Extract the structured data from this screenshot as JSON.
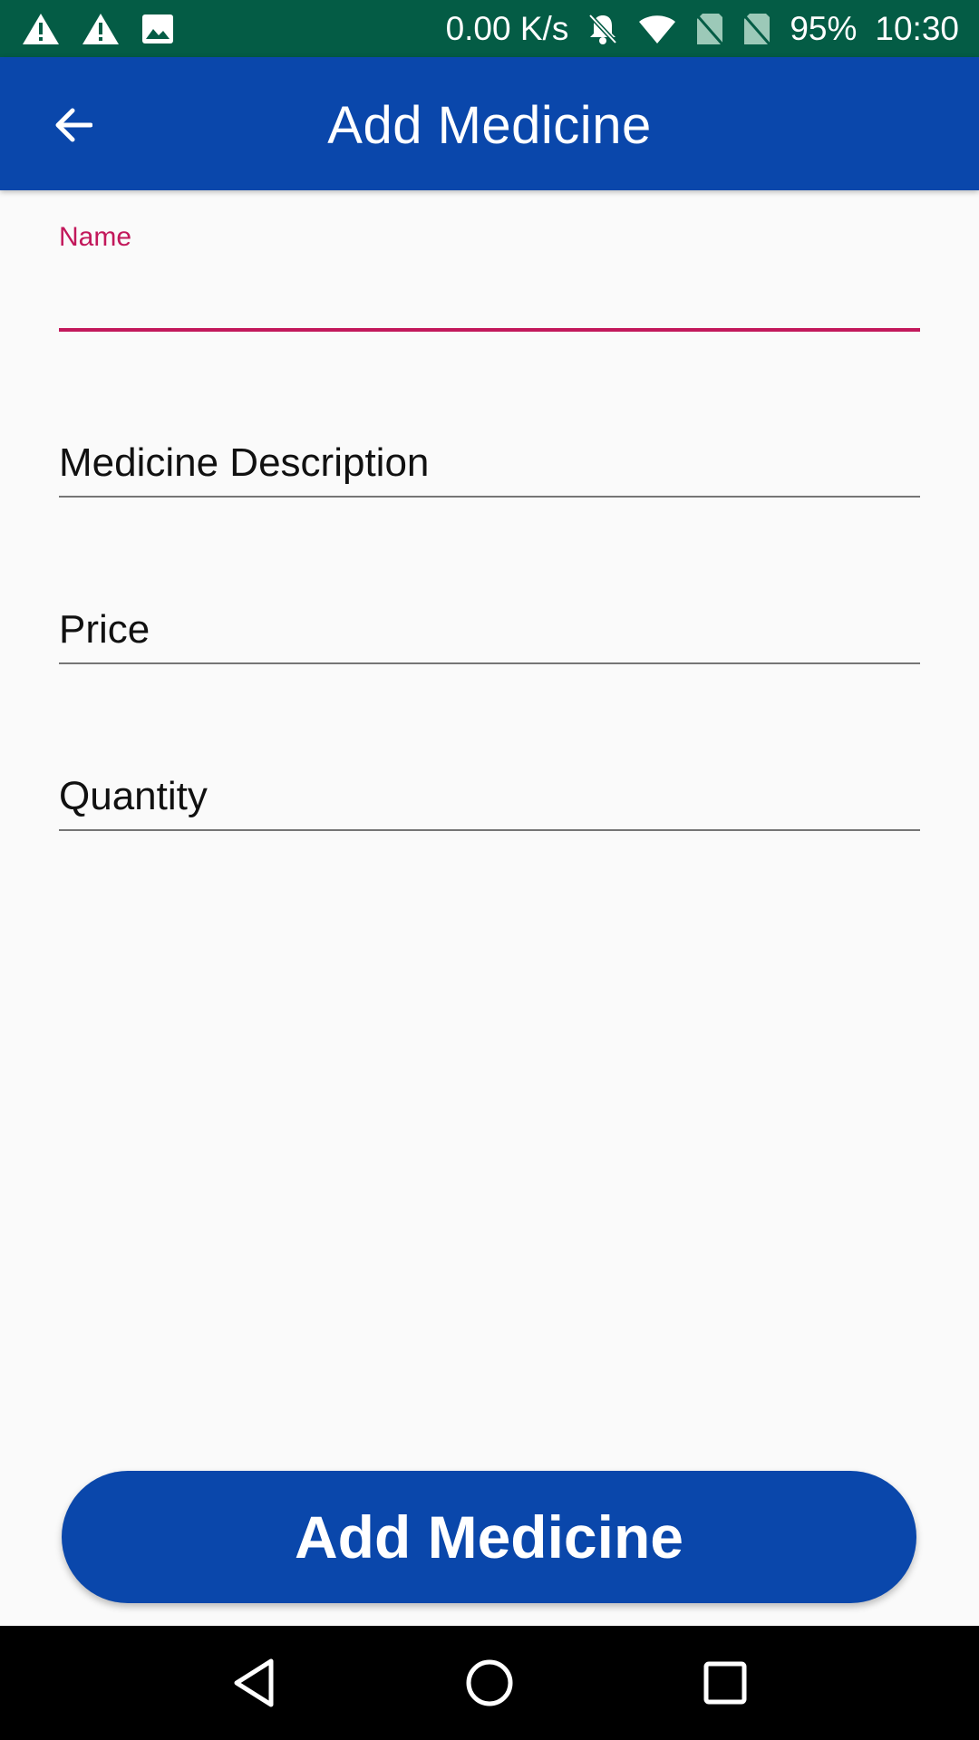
{
  "status_bar": {
    "network_speed": "0.00 K/s",
    "battery": "95%",
    "time": "10:30",
    "icons": [
      "warning-icon",
      "warning-icon",
      "image-icon",
      "bell-off-icon",
      "wifi-icon",
      "no-sim-icon",
      "no-sim-icon"
    ]
  },
  "app_bar": {
    "title": "Add Medicine",
    "back_icon": "arrow-back-icon"
  },
  "form": {
    "name": {
      "label": "Name",
      "value": ""
    },
    "description": {
      "placeholder": "Medicine Description",
      "value": ""
    },
    "price": {
      "placeholder": "Price",
      "value": ""
    },
    "quantity": {
      "placeholder": "Quantity",
      "value": ""
    }
  },
  "submit_button": {
    "label": "Add Medicine"
  },
  "nav_bar": {
    "icons": [
      "back-triangle-icon",
      "home-circle-icon",
      "recents-square-icon"
    ]
  },
  "colors": {
    "status_bar": "#045C45",
    "app_bar": "#0A47AB",
    "accent": "#C2185B",
    "background": "#FAFAFA"
  }
}
